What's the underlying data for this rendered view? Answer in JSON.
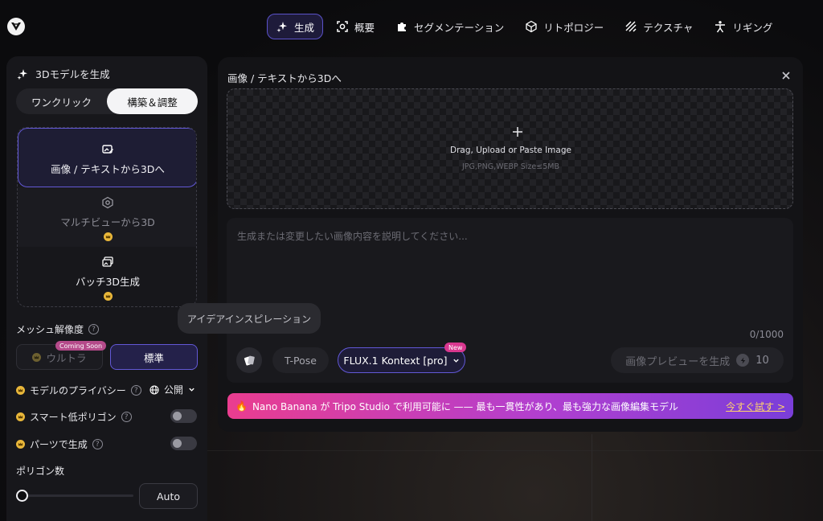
{
  "nav": {
    "items": [
      {
        "label": "生成",
        "icon": "sparkle-icon",
        "active": true
      },
      {
        "label": "概要",
        "icon": "frame-icon",
        "active": false
      },
      {
        "label": "セグメンテーション",
        "icon": "puzzle-icon",
        "active": false
      },
      {
        "label": "リトポロジー",
        "icon": "cube-icon",
        "active": false
      },
      {
        "label": "テクスチャ",
        "icon": "stripes-icon",
        "active": false
      },
      {
        "label": "リギング",
        "icon": "figure-icon",
        "active": false
      }
    ]
  },
  "left": {
    "title": "3Dモデルを生成",
    "segment": {
      "one_click": "ワンクリック",
      "build": "構築＆調整"
    },
    "modes": [
      {
        "label": "画像 / テキストから3Dへ"
      },
      {
        "label": "マルチビューから3D"
      },
      {
        "label": "バッチ3D生成"
      }
    ],
    "mesh_resolution_label": "メッシュ解像度",
    "ultra_label": "ウルトラ",
    "coming_soon": "Coming Soon",
    "standard_label": "標準",
    "privacy_label": "モデルのプライバシー",
    "privacy_value": "公開",
    "smart_lowpoly_label": "スマート低ポリゴン",
    "parts_label": "パーツで生成",
    "polycount_label": "ポリゴン数",
    "polycount_slider_value": 0,
    "auto_label": "Auto"
  },
  "main": {
    "title": "画像 / テキストから3Dへ",
    "drop_text": "Drag, Upload or Paste Image",
    "drop_sub": "JPG,PNG,WEBP Size≤5MB",
    "prompt_placeholder": "生成または変更したい画像内容を説明してください...",
    "counter": "0/1000",
    "tpose_label": "T-Pose",
    "model_label": "FLUX.1 Kontext [pro]",
    "new_badge": "New",
    "generate_label": "画像プレビューを生成",
    "generate_cost": "10",
    "tooltip": "アイデアインスピレーション",
    "banner_text": "Nano Banana が Tripo Studio で利用可能に —— 最も一貫性があり、最も強力な画像編集モデル",
    "banner_link": "今すぐ試す >"
  },
  "colors": {
    "accent": "#6258d6",
    "premium": "#e9b73a",
    "banner_start": "#ea3d8f",
    "banner_end": "#7a3ed9"
  }
}
